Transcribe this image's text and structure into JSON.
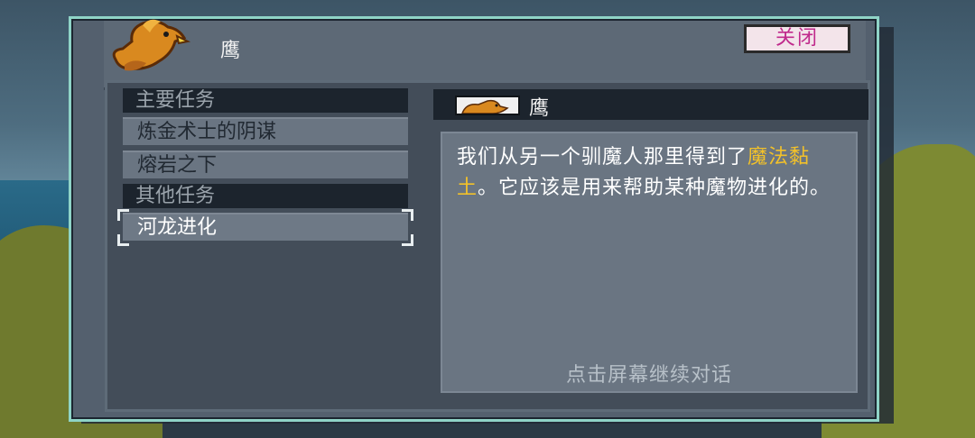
{
  "dialog": {
    "title": "鹰",
    "close_label": "关闭"
  },
  "quests": {
    "categories": [
      {
        "label": "主要任务",
        "items": [
          {
            "label": "炼金术士的阴谋"
          },
          {
            "label": "熔岩之下"
          }
        ]
      },
      {
        "label": "其他任务",
        "items": [
          {
            "label": "河龙进化",
            "selected": true
          }
        ]
      }
    ]
  },
  "detail": {
    "speaker": "鹰",
    "text_before": "我们从另一个驯魔人那里得到了",
    "highlight": "魔法黏土",
    "text_after": "。它应该是用来帮助某种魔物进化的。",
    "hint": "点击屏幕继续对话"
  },
  "colors": {
    "border_accent": "#8fd4c7",
    "highlight": "#f2c12a",
    "close_text": "#c02a8c"
  },
  "icons": [
    "eagle-avatar-icon",
    "eagle-speaker-icon"
  ]
}
